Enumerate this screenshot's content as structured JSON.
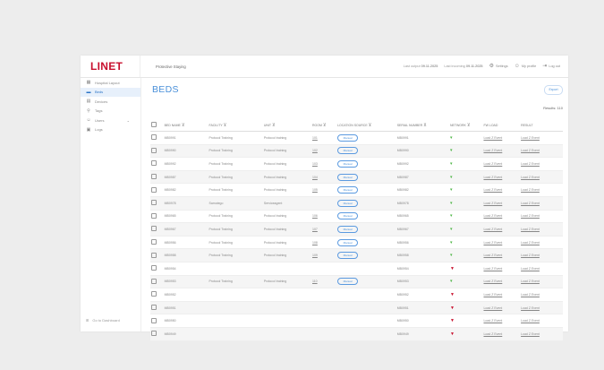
{
  "app": {
    "logo": "LINET",
    "project": "Protective Staying"
  },
  "topbar": {
    "conn1_label": "Last output",
    "conn1_value": "09.11.2025",
    "conn2_label": "Last incoming",
    "conn2_value": "09.11.2025",
    "settings": "Settings",
    "my_profile": "My profile",
    "logout": "Log out"
  },
  "sidebar": {
    "items": [
      {
        "icon": "layout-icon",
        "glyph": "▦",
        "label": "Hospital Layout",
        "active": false
      },
      {
        "icon": "bed-icon",
        "glyph": "▬",
        "label": "Beds",
        "active": true
      },
      {
        "icon": "devices-icon",
        "glyph": "▤",
        "label": "Devices",
        "active": false
      },
      {
        "icon": "tags-icon",
        "glyph": "⚲",
        "label": "Tags",
        "active": false
      },
      {
        "icon": "users-icon",
        "glyph": "☺",
        "label": "Users",
        "active": false,
        "expandable": true
      },
      {
        "icon": "logs-icon",
        "glyph": "▣",
        "label": "Logs",
        "active": false
      }
    ],
    "footer": "Go to Dashboard"
  },
  "main": {
    "title": "BEDS",
    "export": "Export",
    "results": "Results: 110"
  },
  "table": {
    "columns": [
      "BED NAME",
      "FACILITY",
      "UNIT",
      "ROOM",
      "LOCATION SOURCE",
      "SERIAL NUMBER",
      "NETWORK",
      "FW LOAD",
      "RESULT"
    ],
    "rows": [
      {
        "bed": "MB0991",
        "facility": "Protocol Training",
        "unit": "Protocol training",
        "room": "101",
        "source": "Manual",
        "serial": "MB0991",
        "network": "on",
        "fw": "Load Z Event",
        "result": "Load Z Event"
      },
      {
        "bed": "MB0990",
        "facility": "Protocol Training",
        "unit": "Protocol training",
        "room": "102",
        "source": "Manual",
        "serial": "MB0990",
        "network": "on",
        "fw": "Load Z Event",
        "result": "Load Z Event"
      },
      {
        "bed": "MB0992",
        "facility": "Protocol Training",
        "unit": "Protocol training",
        "room": "103",
        "source": "Manual",
        "serial": "MB0992",
        "network": "on",
        "fw": "Load Z Event",
        "result": "Load Z Event"
      },
      {
        "bed": "MB0987",
        "facility": "Protocol Training",
        "unit": "Protocol training",
        "room": "104",
        "source": "Manual",
        "serial": "MB0987",
        "network": "on",
        "fw": "Load Z Event",
        "result": "Load Z Event"
      },
      {
        "bed": "MB0982",
        "facility": "Protocol Training",
        "unit": "Protocol training",
        "room": "105",
        "source": "Manual",
        "serial": "MB0982",
        "network": "on",
        "fw": "Load Z Event",
        "result": "Load Z Event"
      },
      {
        "bed": "MB0978",
        "facility": "Samotego",
        "unit": "Serviceagent",
        "room": "",
        "source": "Manual",
        "serial": "MB0978",
        "network": "on",
        "fw": "Load Z Event",
        "result": "Load Z Event"
      },
      {
        "bed": "MB0965",
        "facility": "Protocol Training",
        "unit": "Protocol training",
        "room": "106",
        "source": "Manual",
        "serial": "MB0965",
        "network": "on",
        "fw": "Load Z Event",
        "result": "Load Z Event"
      },
      {
        "bed": "MB0967",
        "facility": "Protocol Training",
        "unit": "Protocol training",
        "room": "107",
        "source": "Manual",
        "serial": "MB0967",
        "network": "on",
        "fw": "Load Z Event",
        "result": "Load Z Event"
      },
      {
        "bed": "MB0956",
        "facility": "Protocol Training",
        "unit": "Protocol training",
        "room": "108",
        "source": "Manual",
        "serial": "MB0956",
        "network": "on",
        "fw": "Load Z Event",
        "result": "Load Z Event"
      },
      {
        "bed": "MB0958",
        "facility": "Protocol Training",
        "unit": "Protocol training",
        "room": "109",
        "source": "Manual",
        "serial": "MB0958",
        "network": "on",
        "fw": "Load Z Event",
        "result": "Load Z Event"
      },
      {
        "bed": "MB0954",
        "facility": "",
        "unit": "",
        "room": "",
        "source": "",
        "serial": "MB0954",
        "network": "off",
        "fw": "Load Z Event",
        "result": "Load Z Event"
      },
      {
        "bed": "MB0953",
        "facility": "Protocol Training",
        "unit": "Protocol training",
        "room": "110",
        "source": "Manual",
        "serial": "MB0953",
        "network": "on",
        "fw": "Load Z Event",
        "result": "Load Z Event"
      },
      {
        "bed": "MB0952",
        "facility": "",
        "unit": "",
        "room": "",
        "source": "",
        "serial": "MB0952",
        "network": "off",
        "fw": "Load Z Event",
        "result": "Load Z Event"
      },
      {
        "bed": "MB0951",
        "facility": "",
        "unit": "",
        "room": "",
        "source": "",
        "serial": "MB0951",
        "network": "off",
        "fw": "Load Z Event",
        "result": "Load Z Event"
      },
      {
        "bed": "MB0950",
        "facility": "",
        "unit": "",
        "room": "",
        "source": "",
        "serial": "MB0950",
        "network": "off",
        "fw": "Load Z Event",
        "result": "Load Z Event"
      },
      {
        "bed": "MB0949",
        "facility": "",
        "unit": "",
        "room": "",
        "source": "",
        "serial": "MB0949",
        "network": "off",
        "fw": "Load Z Event",
        "result": "Load Z Event"
      }
    ]
  }
}
